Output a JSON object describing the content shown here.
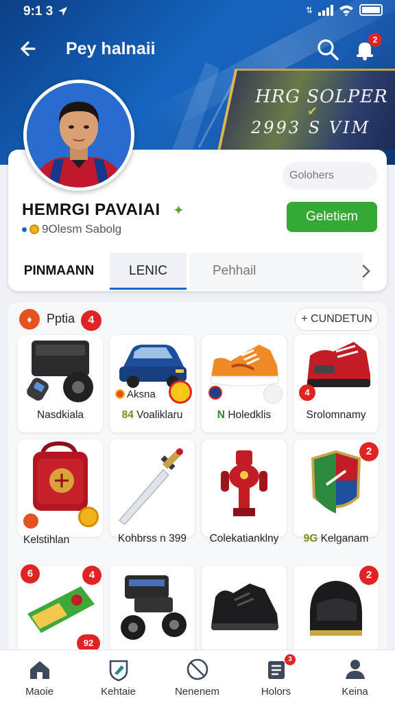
{
  "status_bar": {
    "time": "9:1 3"
  },
  "app_bar": {
    "title": "Pey halnaii",
    "notification_count": "2"
  },
  "banner": {
    "title": "HRG SOLPER",
    "subtitle": "2993 S   VIM"
  },
  "profile": {
    "name": "HEMRGI PAVAIAI",
    "subtitle": "9Olesm Sabolg",
    "chip_label": "Golohers",
    "primary_button": "Geletiem"
  },
  "tabs": [
    {
      "label": "PINMAANN"
    },
    {
      "label": "LENIC"
    },
    {
      "label": "Pehhail"
    }
  ],
  "section": {
    "title": "Pptia",
    "count": "4",
    "action": "+ CUNDETUN",
    "badge": "♦"
  },
  "items": [
    {
      "label": "Nasdkiala"
    },
    {
      "label": "Voaliklaru",
      "prefix": "84",
      "overlay": "Aksna"
    },
    {
      "label": "Holedklis",
      "prefix": "N"
    },
    {
      "label": "Srolomnamy",
      "badge": "4"
    },
    {
      "label": "Kelstihlan"
    },
    {
      "label": "Kohbrss n  399"
    },
    {
      "label": "Colekatianklny"
    },
    {
      "label": "Kelganam",
      "prefix": "9G",
      "badge": "2"
    },
    {
      "label": "",
      "badge": "4",
      "badge_left": "6"
    },
    {
      "label": "",
      "badge": "92"
    },
    {
      "label": ""
    },
    {
      "label": "",
      "badge": "2"
    }
  ],
  "bottom_nav": [
    {
      "label": "Maoie",
      "icon": "home-icon"
    },
    {
      "label": "Kehtaie",
      "icon": "shield-icon"
    },
    {
      "label": "Nenenem",
      "icon": "block-icon"
    },
    {
      "label": "Holors",
      "icon": "list-icon",
      "badge": "3"
    },
    {
      "label": "Keina",
      "icon": "person-icon"
    }
  ],
  "colors": {
    "primary_blue": "#1565c0",
    "accent_green": "#34a933",
    "badge_red": "#e02424"
  }
}
